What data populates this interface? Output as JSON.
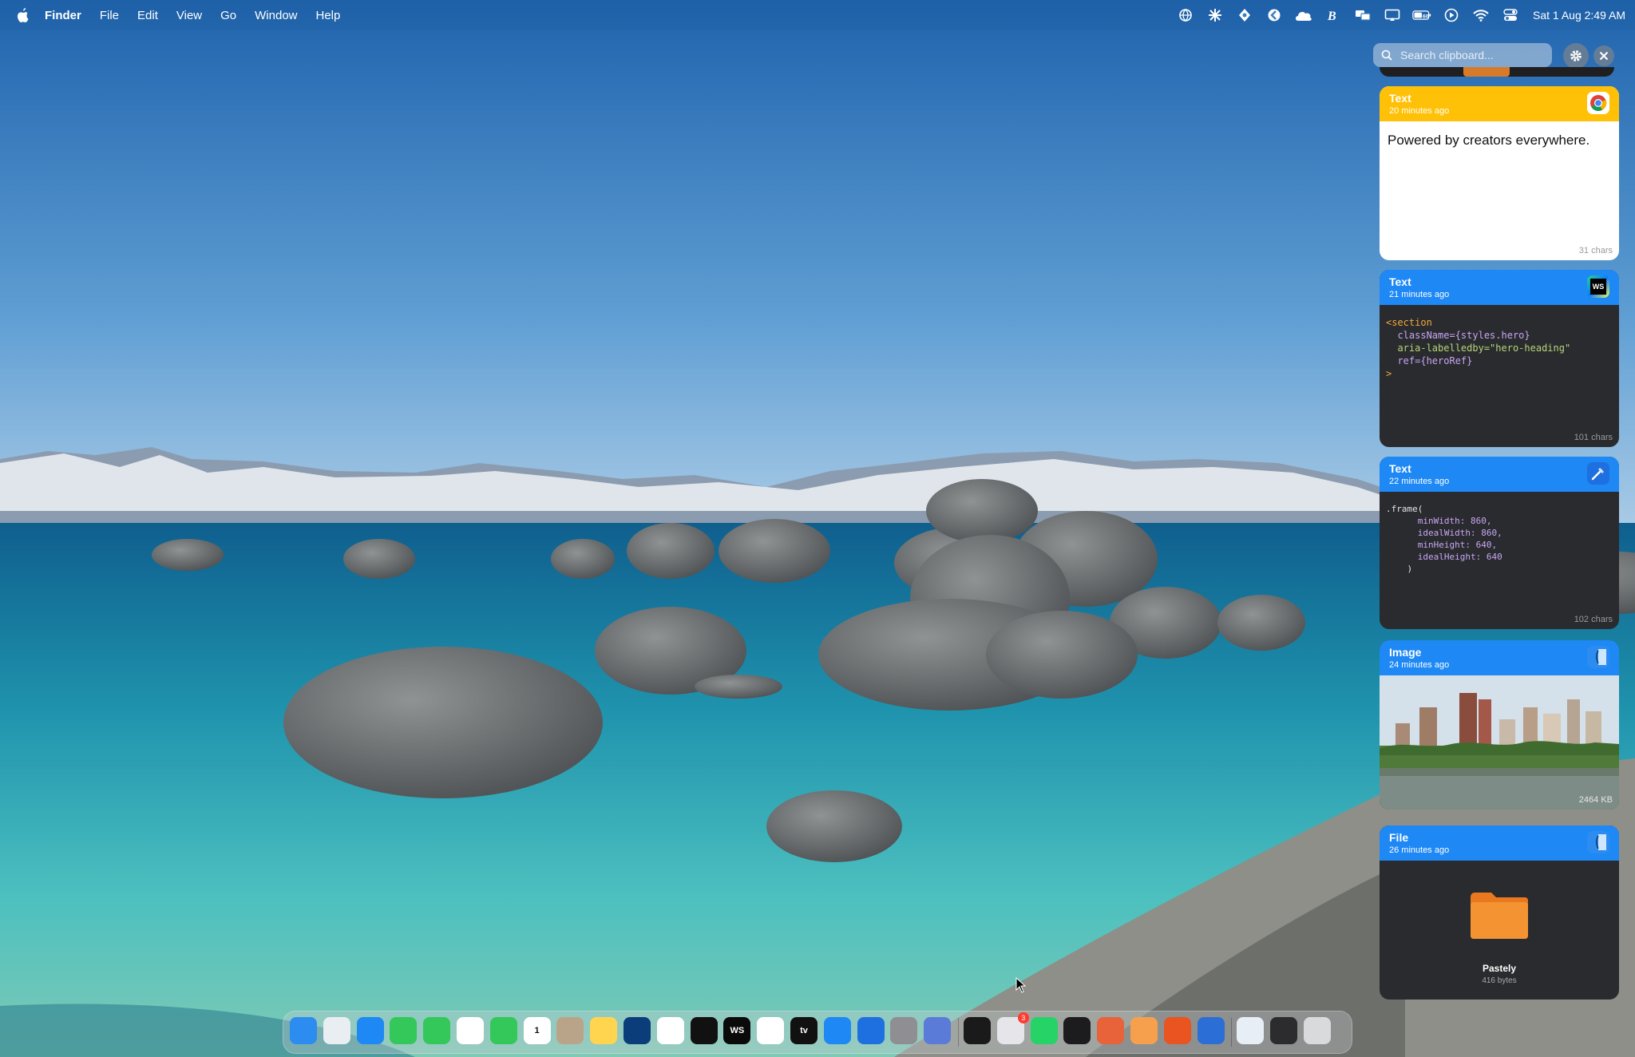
{
  "menubar": {
    "app_name": "Finder",
    "menus": [
      "File",
      "Edit",
      "View",
      "Go",
      "Window",
      "Help"
    ],
    "clock": "Sat 1 Aug  2:49 AM",
    "battery": "60"
  },
  "clipboard_panel": {
    "search_placeholder": "Search clipboard...",
    "items": [
      {
        "type": "Text",
        "time": "20 minutes ago",
        "app": "chrome-icon",
        "content": "Powered by creators everywhere.",
        "size": "31 chars",
        "header_color": "#FFC107"
      },
      {
        "type": "Text",
        "time": "21 minutes ago",
        "app": "webstorm-icon",
        "code_lines": [
          "<section",
          "  className={styles.hero}",
          "  aria-labelledby=\"hero-heading\"",
          "  ref={heroRef}",
          ">"
        ],
        "size": "101 chars",
        "header_color": "#1E88F5"
      },
      {
        "type": "Text",
        "time": "22 minutes ago",
        "app": "xcode-icon",
        "code_lines": [
          ".frame(",
          "      minWidth: 860,",
          "      idealWidth: 860,",
          "      minHeight: 640,",
          "      idealHeight: 640",
          "    )"
        ],
        "size": "102 chars",
        "header_color": "#1E88F5"
      },
      {
        "type": "Image",
        "time": "24 minutes ago",
        "app": "finder-icon",
        "image": "city-skyline-over-lake",
        "size": "2464 KB",
        "header_color": "#1E88F5"
      },
      {
        "type": "File",
        "time": "26 minutes ago",
        "app": "finder-icon",
        "file_name": "Pastely",
        "file_size": "416 bytes",
        "header_color": "#1E88F5"
      }
    ]
  },
  "dock": {
    "apps": [
      {
        "name": "Finder",
        "icon": "finder-icon",
        "color": "#2d8cf0"
      },
      {
        "name": "Launchpad",
        "icon": "launchpad-icon",
        "color": "#e9eef3"
      },
      {
        "name": "Safari",
        "icon": "safari-icon",
        "color": "#1e88f5"
      },
      {
        "name": "Phone",
        "icon": "phone-icon",
        "color": "#34c759"
      },
      {
        "name": "Messages",
        "icon": "messages-icon",
        "color": "#34c759"
      },
      {
        "name": "Photos",
        "icon": "photos-icon",
        "color": "#ffffff"
      },
      {
        "name": "FaceTime",
        "icon": "facetime-icon",
        "color": "#34c759"
      },
      {
        "name": "Calendar",
        "icon": "calendar-icon",
        "color": "#ffffff",
        "label": "1"
      },
      {
        "name": "Contacts",
        "icon": "contacts-icon",
        "color": "#b9a48a"
      },
      {
        "name": "Notes",
        "icon": "notes-icon",
        "color": "#ffd54f"
      },
      {
        "name": "Freeform",
        "icon": "freeform-icon",
        "color": "#0b3d7a"
      },
      {
        "name": "Chrome",
        "icon": "chrome-icon",
        "color": "#ffffff"
      },
      {
        "name": "Spotify",
        "icon": "spotify-icon",
        "color": "#111111"
      },
      {
        "name": "WebStorm",
        "icon": "webstorm-icon",
        "color": "#0a0a0a",
        "label": "WS"
      },
      {
        "name": "Instruments",
        "icon": "instruments-icon",
        "color": "#ffffff"
      },
      {
        "name": "TV",
        "icon": "tv-icon",
        "color": "#111111",
        "label": "tv"
      },
      {
        "name": "App Store",
        "icon": "app-store-icon",
        "color": "#1e88f5"
      },
      {
        "name": "Xcode",
        "icon": "xcode-icon",
        "color": "#1e6fe0"
      },
      {
        "name": "System Settings",
        "icon": "settings-icon",
        "color": "#8e8e93"
      },
      {
        "name": "Simulator",
        "icon": "simulator-icon",
        "color": "#5b7bd8"
      },
      {
        "name": "Robot",
        "icon": "robot-icon",
        "color": "#1a1a1a"
      },
      {
        "name": "Shortcuts",
        "icon": "shortcuts-icon",
        "color": "#e5e5ea",
        "badge": "3"
      },
      {
        "name": "WhatsApp",
        "icon": "whatsapp-icon",
        "color": "#25d366"
      },
      {
        "name": "Terminal",
        "icon": "terminal-icon",
        "color": "#1c1c1e"
      },
      {
        "name": "Claude",
        "icon": "claude-icon",
        "color": "#e8623a"
      },
      {
        "name": "Cloudflare",
        "icon": "cloudflare-icon",
        "color": "#f6a04d"
      },
      {
        "name": "Ubuntu",
        "icon": "ubuntu-icon",
        "color": "#e95420"
      },
      {
        "name": "Word",
        "icon": "word-icon",
        "color": "#2b6fd6"
      },
      {
        "name": "Preview",
        "icon": "preview-icon",
        "color": "#e8eef5"
      },
      {
        "name": "Window Manager",
        "icon": "window-manager-icon",
        "color": "#2c2c2e"
      },
      {
        "name": "Trash",
        "icon": "trash-icon",
        "color": "#d8dadc"
      }
    ]
  }
}
